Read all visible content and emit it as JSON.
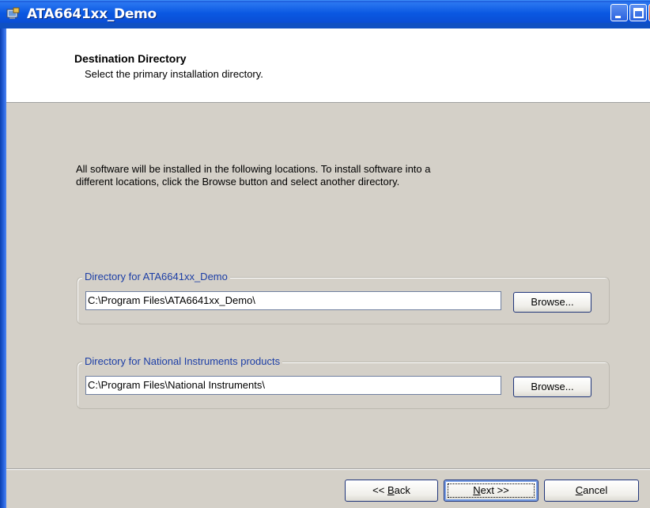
{
  "window": {
    "title": "ATA6641xx_Demo"
  },
  "header": {
    "title": "Destination Directory",
    "subtitle": "Select the primary installation directory."
  },
  "intro": {
    "line1": "All software will be installed in the following locations. To install software into a",
    "line2": "different locations, click the Browse button and select another directory."
  },
  "groups": [
    {
      "legend": "Directory for ATA6641xx_Demo",
      "path": "C:\\Program Files\\ATA6641xx_Demo\\",
      "browse_label": "Browse..."
    },
    {
      "legend": "Directory for National Instruments products",
      "path": "C:\\Program Files\\National Instruments\\",
      "browse_label": "Browse..."
    }
  ],
  "footer": {
    "back_prefix": "<< ",
    "back_underlined": "B",
    "back_rest": "ack",
    "next_underlined": "N",
    "next_rest": "ext >>",
    "cancel_underlined": "C",
    "cancel_rest": "ancel"
  },
  "colors": {
    "title_bar": "#0a58e2",
    "legend_text": "#1c3ea6",
    "dialog_bg": "#d4d0c8",
    "close_button": "#c8401c"
  },
  "icons": {
    "app": "installer-app-icon",
    "minimize": "minimize-icon",
    "maximize": "maximize-icon",
    "close": "close-icon"
  }
}
